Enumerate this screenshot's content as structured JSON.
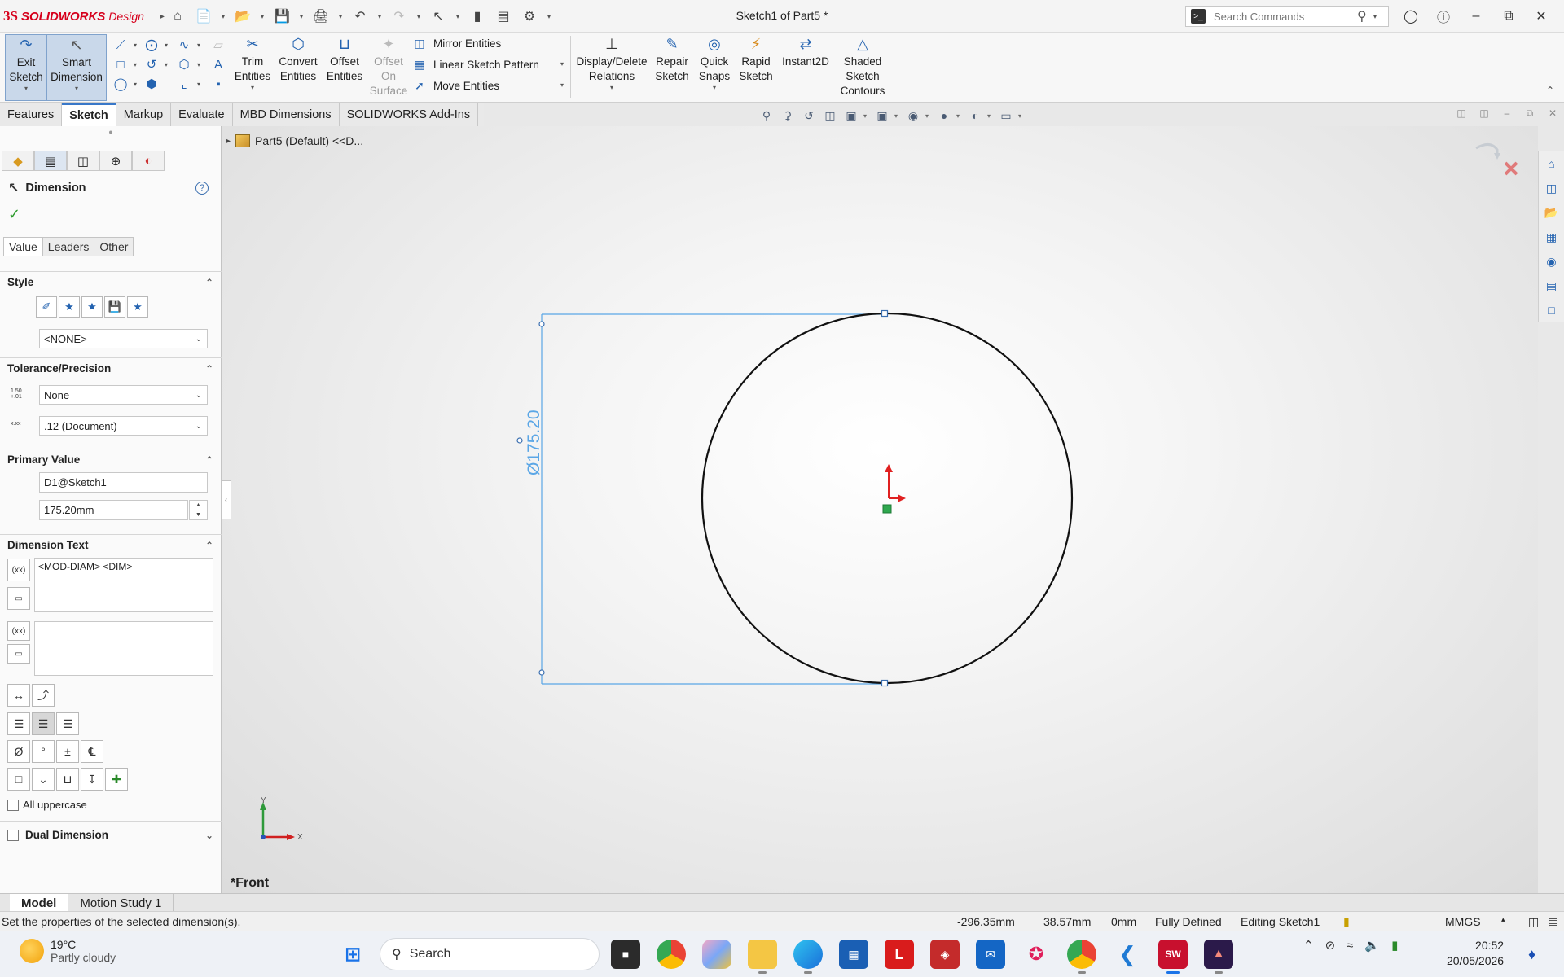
{
  "app": {
    "brand_ds": "3S",
    "brand_name": "SOLIDWORKS",
    "brand_suffix": "Design",
    "doc_title": "Sketch1 of Part5 *"
  },
  "search": {
    "placeholder": "Search Commands"
  },
  "commands": {
    "exit_sketch": [
      "Exit",
      "Sketch"
    ],
    "smart_dimension": [
      "Smart",
      "Dimension"
    ],
    "trim": [
      "Trim",
      "Entities"
    ],
    "convert": [
      "Convert",
      "Entities"
    ],
    "offset": [
      "Offset",
      "Entities"
    ],
    "offset_surface": [
      "Offset",
      "On",
      "Surface"
    ],
    "mirror": "Mirror Entities",
    "linear_pattern": "Linear Sketch Pattern",
    "move": "Move Entities",
    "display_delete": [
      "Display/Delete",
      "Relations"
    ],
    "repair": [
      "Repair",
      "Sketch"
    ],
    "quick_snaps": [
      "Quick",
      "Snaps"
    ],
    "rapid": [
      "Rapid",
      "Sketch"
    ],
    "instant2d": "Instant2D",
    "shaded": [
      "Shaded",
      "Sketch",
      "Contours"
    ]
  },
  "tabs": [
    "Features",
    "Sketch",
    "Markup",
    "Evaluate",
    "MBD Dimensions",
    "SOLIDWORKS Add-Ins"
  ],
  "active_tab": "Sketch",
  "tree_flyout": "Part5 (Default) <<D...",
  "property_manager": {
    "title": "Dimension",
    "subtabs": [
      "Value",
      "Leaders",
      "Other"
    ],
    "style": {
      "header": "Style",
      "select": "<NONE>"
    },
    "tolerance": {
      "header": "Tolerance/Precision",
      "tolerance_type": "None",
      "precision": ".12 (Document)",
      "tol_icon_top": "1.50",
      "tol_icon_sub": "+.01",
      "prec_icon": "x.xx"
    },
    "primary_value": {
      "header": "Primary Value",
      "name": "D1@Sketch1",
      "value": "175.20mm"
    },
    "dimension_text": {
      "header": "Dimension Text",
      "text": "<MOD-DIAM> <DIM>"
    },
    "all_uppercase": "All uppercase",
    "dual_dimension": "Dual Dimension"
  },
  "sketch": {
    "dimension_label": "Ø175.20",
    "view_name": "*Front",
    "axis_x": "X",
    "axis_y": "Y"
  },
  "bottom_tabs": [
    "Model",
    "Motion Study 1"
  ],
  "status": {
    "message": "Set the properties of the selected dimension(s).",
    "x": "-296.35mm",
    "y": "38.57mm",
    "z": "0mm",
    "state": "Fully Defined",
    "editing": "Editing Sketch1",
    "units": "MMGS"
  },
  "taskbar": {
    "temp": "19°C",
    "weather": "Partly cloudy",
    "search": "Search",
    "time": "20:52",
    "date": "20/05/2026"
  },
  "colors": {
    "accent": "#3978c9",
    "dimension": "#5aa6e6",
    "brand_red": "#d6001c"
  }
}
